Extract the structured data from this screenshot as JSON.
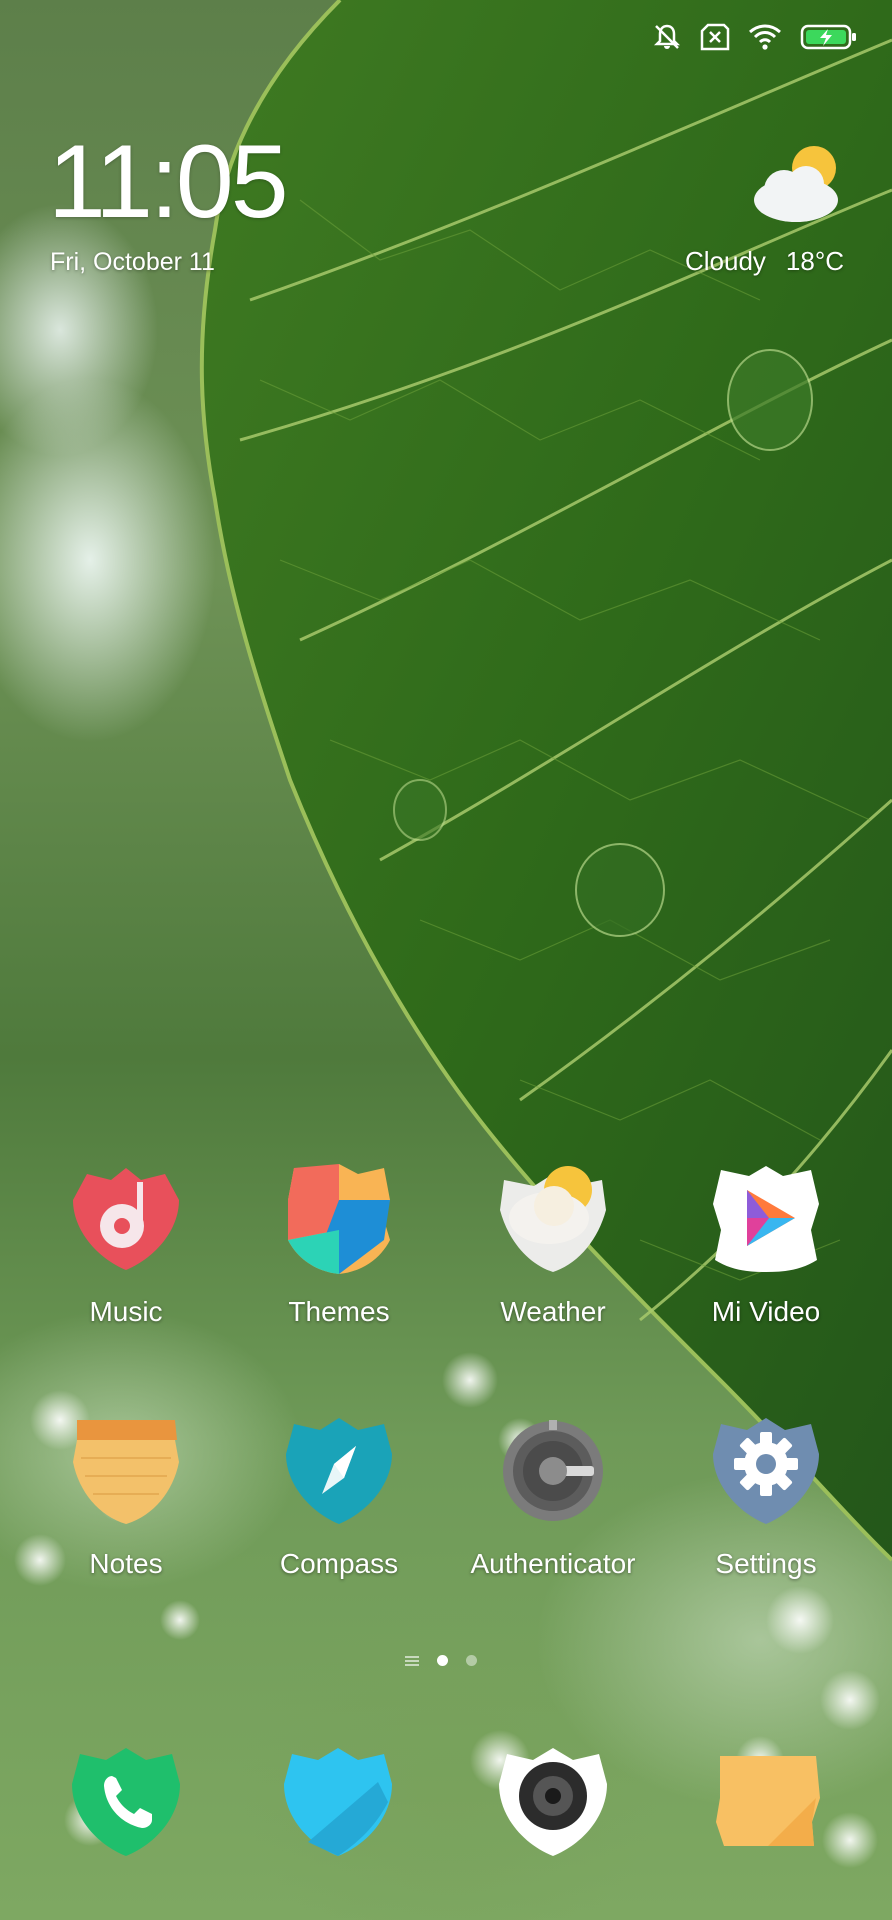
{
  "status_bar": {
    "icons": [
      "bell-muted-icon",
      "sim-no-service-icon",
      "wifi-icon",
      "battery-charging-icon"
    ]
  },
  "lockscreen": {
    "time": "11:05",
    "date": "Fri, October 11",
    "weather": {
      "condition": "Cloudy",
      "temperature": "18°C",
      "icon": "cloud-sun-icon"
    }
  },
  "apps": [
    {
      "label": "Music",
      "icon": "music-icon",
      "color": "#e8505b"
    },
    {
      "label": "Themes",
      "icon": "themes-icon",
      "color": "#f26b5b"
    },
    {
      "label": "Weather",
      "icon": "weather-icon",
      "color": "#f5c242"
    },
    {
      "label": "Mi Video",
      "icon": "mi-video-icon",
      "color": "#ffffff"
    },
    {
      "label": "Notes",
      "icon": "notes-icon",
      "color": "#f3c16a"
    },
    {
      "label": "Compass",
      "icon": "compass-icon",
      "color": "#1aa3b8"
    },
    {
      "label": "Authenticator",
      "icon": "authenticator-icon",
      "color": "#6b6b6b"
    },
    {
      "label": "Settings",
      "icon": "settings-icon",
      "color": "#6f8db0"
    }
  ],
  "page_indicator": {
    "pages": 2,
    "active": 1
  },
  "dock": [
    {
      "icon": "phone-icon",
      "color": "#1fbf6c"
    },
    {
      "icon": "messages-icon",
      "color": "#2ec4f0"
    },
    {
      "icon": "camera-icon",
      "color": "#ffffff"
    },
    {
      "icon": "folder-icon",
      "color": "#f8c063"
    }
  ]
}
